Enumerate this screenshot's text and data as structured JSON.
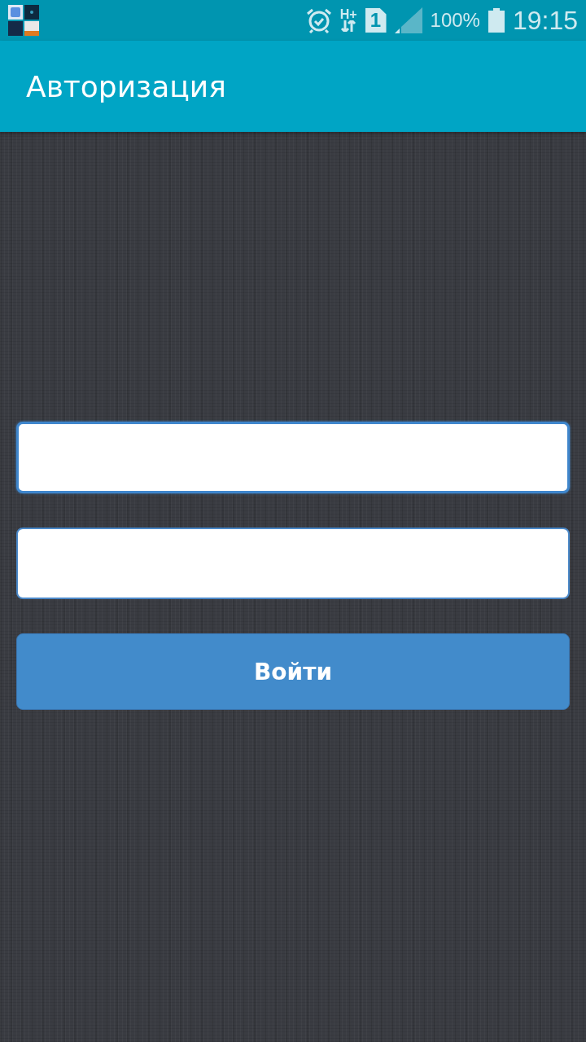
{
  "status_bar": {
    "network": "H+",
    "sim": "1",
    "battery": "100%",
    "time": "19:15"
  },
  "app_bar": {
    "title": "Авторизация"
  },
  "fields": [
    {
      "focused": true
    },
    {
      "focused": false
    }
  ],
  "login_button": {
    "label": "Войти"
  }
}
